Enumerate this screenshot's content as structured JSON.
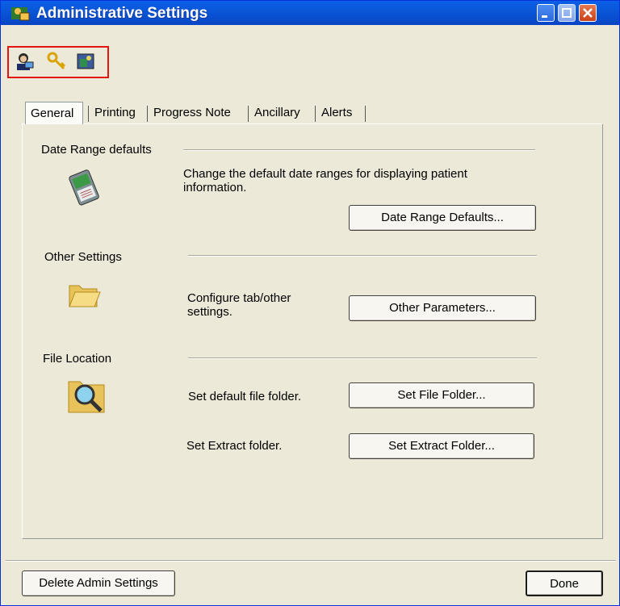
{
  "window": {
    "title": "Administrative Settings"
  },
  "toolbar": {
    "icons": [
      "user-admin-icon",
      "key-icon",
      "settings-image-icon"
    ]
  },
  "tabs": [
    {
      "label": "General"
    },
    {
      "label": "Printing"
    },
    {
      "label": "Progress Note"
    },
    {
      "label": "Ancillary"
    },
    {
      "label": "Alerts"
    }
  ],
  "general": {
    "date_range": {
      "label": "Date Range defaults",
      "description": "Change the default date ranges for displaying patient information.",
      "button": "Date Range Defaults..."
    },
    "other": {
      "label": "Other Settings",
      "description": "Configure tab/other settings.",
      "button": "Other Parameters..."
    },
    "file_location": {
      "label": "File Location",
      "file_description": "Set default file folder.",
      "file_button": "Set File Folder...",
      "extract_description": "Set Extract folder.",
      "extract_button": "Set Extract Folder..."
    }
  },
  "footer": {
    "delete_button": "Delete Admin Settings",
    "done_button": "Done"
  },
  "colors": {
    "titlebar": "#0a57d8",
    "dialog_bg": "#ece9d8",
    "highlight_frame": "#e21414"
  }
}
